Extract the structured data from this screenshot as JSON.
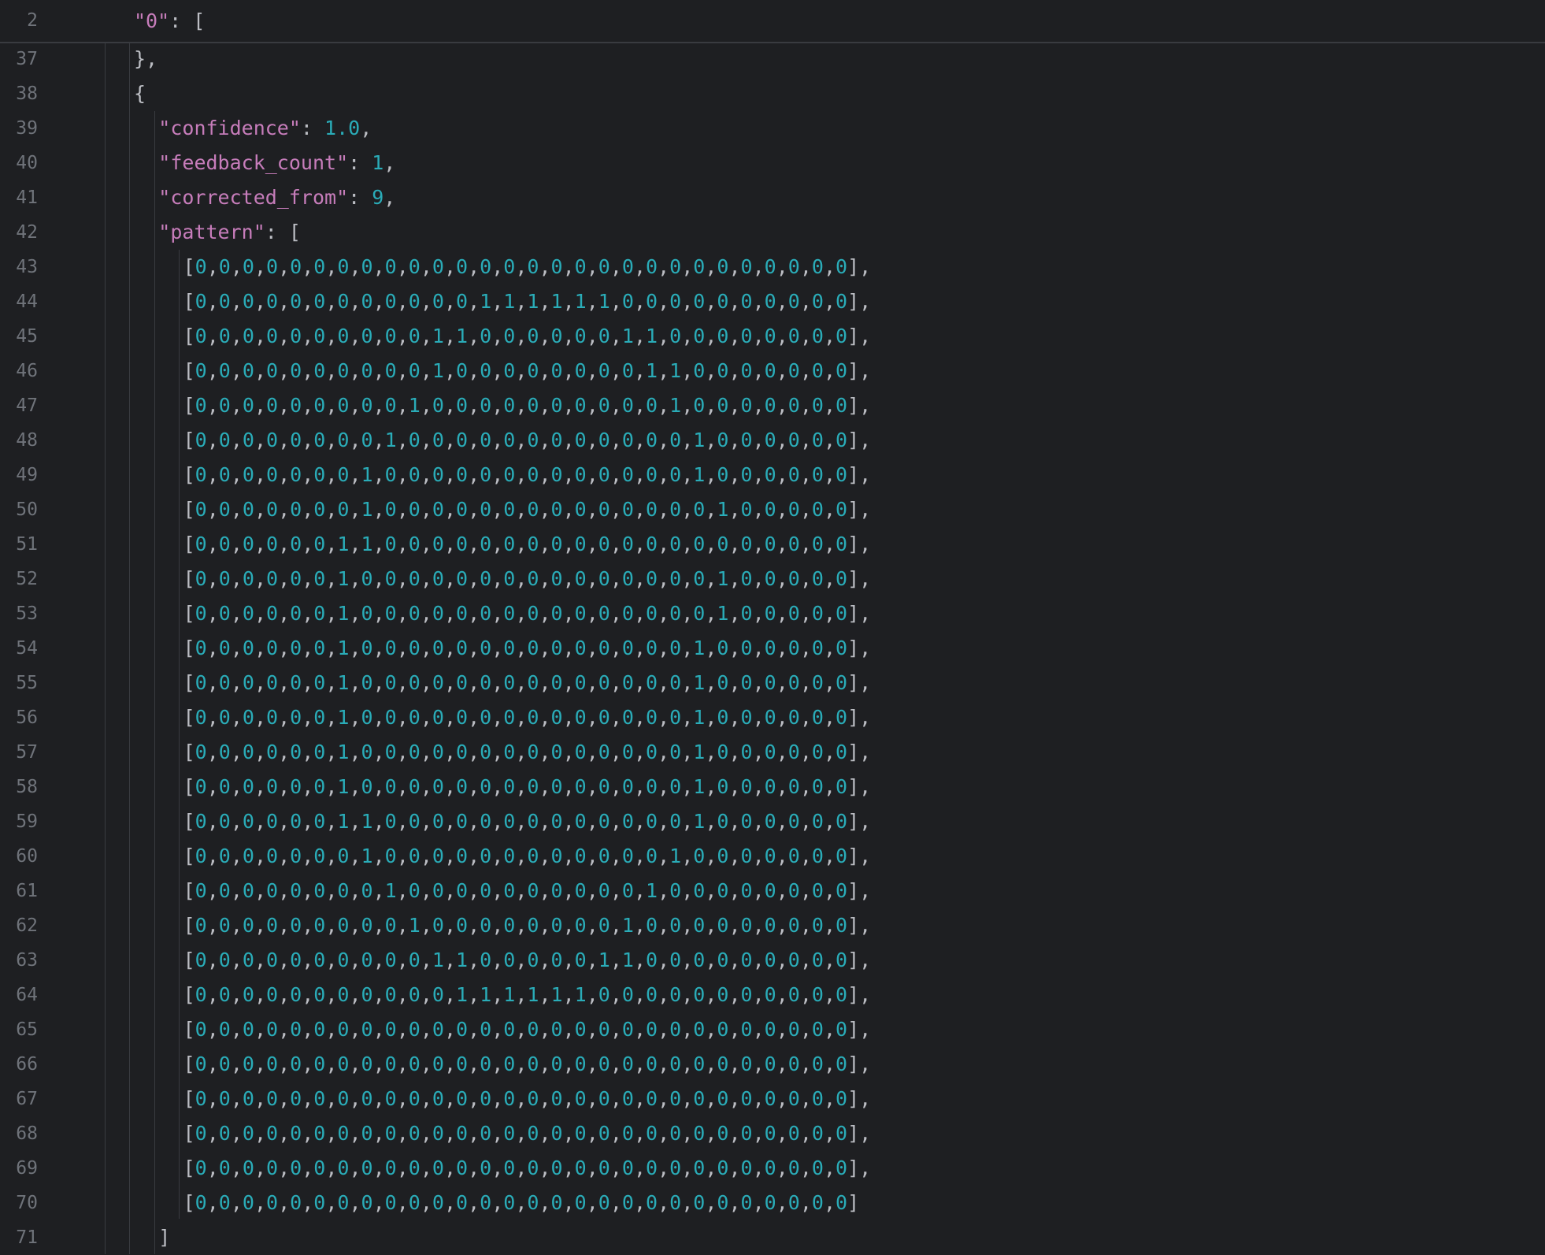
{
  "editor": {
    "accent_color": "#3574f0",
    "key_color": "#c77dbb",
    "number_color": "#2aacb8",
    "sticky": {
      "line_number": "2",
      "text": "\"0\": ["
    },
    "lines": [
      {
        "n": "37",
        "text": "},"
      },
      {
        "n": "38",
        "text": "{"
      },
      {
        "n": "39",
        "text": "\"confidence\": 1.0,"
      },
      {
        "n": "40",
        "text": "\"feedback_count\": 1,"
      },
      {
        "n": "41",
        "text": "\"corrected_from\": 9,"
      },
      {
        "n": "42",
        "text": "\"pattern\": ["
      },
      {
        "n": "43",
        "text": "[0,0,0,0,0,0,0,0,0,0,0,0,0,0,0,0,0,0,0,0,0,0,0,0,0,0,0,0],"
      },
      {
        "n": "44",
        "text": "[0,0,0,0,0,0,0,0,0,0,0,0,1,1,1,1,1,1,0,0,0,0,0,0,0,0,0,0],"
      },
      {
        "n": "45",
        "text": "[0,0,0,0,0,0,0,0,0,0,1,1,0,0,0,0,0,0,1,1,0,0,0,0,0,0,0,0],"
      },
      {
        "n": "46",
        "text": "[0,0,0,0,0,0,0,0,0,0,1,0,0,0,0,0,0,0,0,1,1,0,0,0,0,0,0,0],"
      },
      {
        "n": "47",
        "text": "[0,0,0,0,0,0,0,0,0,1,0,0,0,0,0,0,0,0,0,0,1,0,0,0,0,0,0,0],"
      },
      {
        "n": "48",
        "text": "[0,0,0,0,0,0,0,0,1,0,0,0,0,0,0,0,0,0,0,0,0,1,0,0,0,0,0,0],"
      },
      {
        "n": "49",
        "text": "[0,0,0,0,0,0,0,1,0,0,0,0,0,0,0,0,0,0,0,0,0,1,0,0,0,0,0,0],"
      },
      {
        "n": "50",
        "text": "[0,0,0,0,0,0,0,1,0,0,0,0,0,0,0,0,0,0,0,0,0,0,1,0,0,0,0,0],"
      },
      {
        "n": "51",
        "text": "[0,0,0,0,0,0,1,1,0,0,0,0,0,0,0,0,0,0,0,0,0,0,0,0,0,0,0,0],"
      },
      {
        "n": "52",
        "text": "[0,0,0,0,0,0,1,0,0,0,0,0,0,0,0,0,0,0,0,0,0,0,1,0,0,0,0,0],"
      },
      {
        "n": "53",
        "text": "[0,0,0,0,0,0,1,0,0,0,0,0,0,0,0,0,0,0,0,0,0,0,1,0,0,0,0,0],"
      },
      {
        "n": "54",
        "text": "[0,0,0,0,0,0,1,0,0,0,0,0,0,0,0,0,0,0,0,0,0,1,0,0,0,0,0,0],"
      },
      {
        "n": "55",
        "text": "[0,0,0,0,0,0,1,0,0,0,0,0,0,0,0,0,0,0,0,0,0,1,0,0,0,0,0,0],"
      },
      {
        "n": "56",
        "text": "[0,0,0,0,0,0,1,0,0,0,0,0,0,0,0,0,0,0,0,0,0,1,0,0,0,0,0,0],"
      },
      {
        "n": "57",
        "text": "[0,0,0,0,0,0,1,0,0,0,0,0,0,0,0,0,0,0,0,0,0,1,0,0,0,0,0,0],"
      },
      {
        "n": "58",
        "text": "[0,0,0,0,0,0,1,0,0,0,0,0,0,0,0,0,0,0,0,0,0,1,0,0,0,0,0,0],"
      },
      {
        "n": "59",
        "text": "[0,0,0,0,0,0,1,1,0,0,0,0,0,0,0,0,0,0,0,0,0,1,0,0,0,0,0,0],"
      },
      {
        "n": "60",
        "text": "[0,0,0,0,0,0,0,1,0,0,0,0,0,0,0,0,0,0,0,0,1,0,0,0,0,0,0,0],"
      },
      {
        "n": "61",
        "text": "[0,0,0,0,0,0,0,0,1,0,0,0,0,0,0,0,0,0,0,1,0,0,0,0,0,0,0,0],"
      },
      {
        "n": "62",
        "text": "[0,0,0,0,0,0,0,0,0,1,0,0,0,0,0,0,0,0,1,0,0,0,0,0,0,0,0,0],"
      },
      {
        "n": "63",
        "text": "[0,0,0,0,0,0,0,0,0,0,1,1,0,0,0,0,0,1,1,0,0,0,0,0,0,0,0,0],"
      },
      {
        "n": "64",
        "text": "[0,0,0,0,0,0,0,0,0,0,0,1,1,1,1,1,1,0,0,0,0,0,0,0,0,0,0,0],"
      },
      {
        "n": "65",
        "text": "[0,0,0,0,0,0,0,0,0,0,0,0,0,0,0,0,0,0,0,0,0,0,0,0,0,0,0,0],"
      },
      {
        "n": "66",
        "text": "[0,0,0,0,0,0,0,0,0,0,0,0,0,0,0,0,0,0,0,0,0,0,0,0,0,0,0,0],"
      },
      {
        "n": "67",
        "text": "[0,0,0,0,0,0,0,0,0,0,0,0,0,0,0,0,0,0,0,0,0,0,0,0,0,0,0,0],"
      },
      {
        "n": "68",
        "text": "[0,0,0,0,0,0,0,0,0,0,0,0,0,0,0,0,0,0,0,0,0,0,0,0,0,0,0,0],"
      },
      {
        "n": "69",
        "text": "[0,0,0,0,0,0,0,0,0,0,0,0,0,0,0,0,0,0,0,0,0,0,0,0,0,0,0,0],"
      },
      {
        "n": "70",
        "text": "[0,0,0,0,0,0,0,0,0,0,0,0,0,0,0,0,0,0,0,0,0,0,0,0,0,0,0,0]"
      },
      {
        "n": "71",
        "text": "]"
      }
    ]
  }
}
